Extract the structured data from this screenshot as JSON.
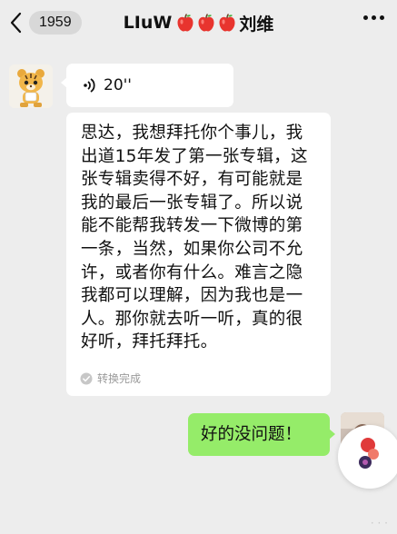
{
  "header": {
    "back_badge": "1959",
    "title": "LIuW",
    "title_suffix": "刘维",
    "title_emojis": [
      "apple-icon",
      "apple-icon",
      "apple-icon"
    ]
  },
  "messages": {
    "voice": {
      "duration": "20''"
    },
    "transcript": {
      "text": "思达，我想拜托你个事儿，我出道15年发了第一张专辑，这张专辑卖得不好，有可能就是我的最后一张专辑了。所以说能不能帮我转发一下微博的第一条，当然，如果你公司不允许，或者你有什么。难言之隐我都可以理解，因为我也是一人。那你就去听一听，真的很好听，拜托拜托。",
      "status": "转换完成"
    },
    "reply": {
      "text": "好的没问题！"
    }
  },
  "colors": {
    "background": "#ededed",
    "bubble_left": "#ffffff",
    "bubble_right": "#95ec69",
    "apple": "#e8342e"
  }
}
